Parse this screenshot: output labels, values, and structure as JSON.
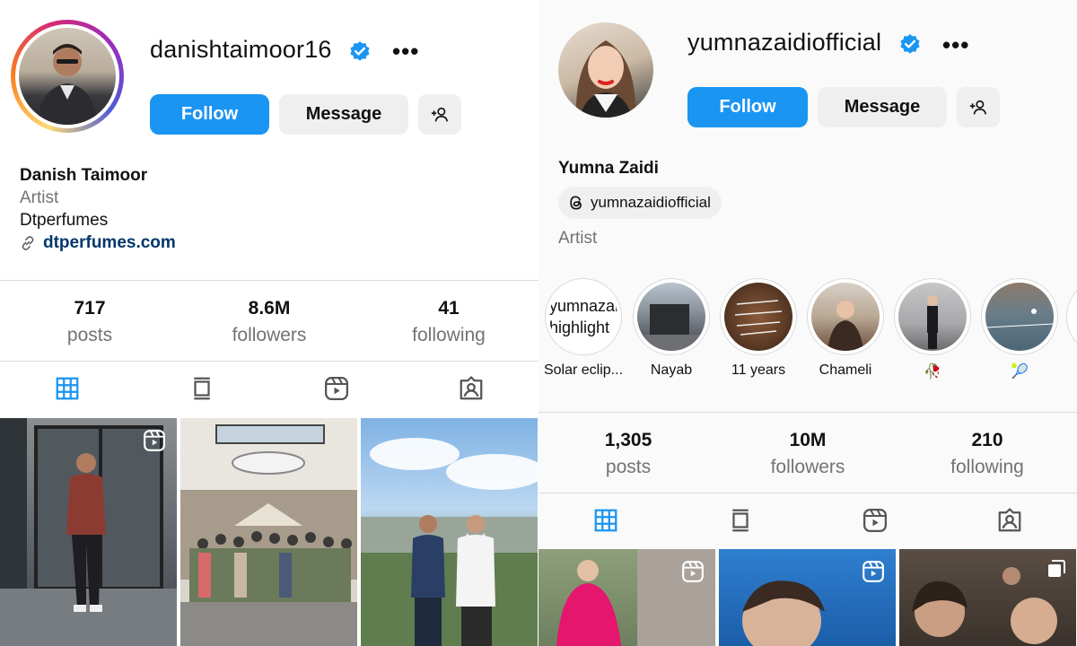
{
  "left_profile": {
    "username": "danishtaimoor16",
    "more": "•••",
    "buttons": {
      "follow": "Follow",
      "message": "Message"
    },
    "name": "Danish Taimoor",
    "category": "Artist",
    "bio": "Dtperfumes",
    "link": "dtperfumes.com",
    "stats": [
      {
        "num": "717",
        "label": "posts"
      },
      {
        "num": "8.6M",
        "label": "followers"
      },
      {
        "num": "41",
        "label": "following"
      }
    ]
  },
  "right_profile": {
    "username": "yumnazaidiofficial",
    "more": "•••",
    "buttons": {
      "follow": "Follow",
      "message": "Message"
    },
    "name": "Yumna Zaidi",
    "threads_handle": "yumnazaidiofficial",
    "category": "Artist",
    "highlights": [
      {
        "label": "Solar eclip...",
        "broken_alt": "yumnazaidi highlight"
      },
      {
        "label": "Nayab"
      },
      {
        "label": "11 years"
      },
      {
        "label": "Chameli"
      },
      {
        "label": "🥀"
      },
      {
        "label": "🎾"
      }
    ],
    "stats": [
      {
        "num": "1,305",
        "label": "posts"
      },
      {
        "num": "10M",
        "label": "followers"
      },
      {
        "num": "210",
        "label": "following"
      }
    ]
  },
  "colors": {
    "accent": "#1a95f2",
    "verified": "#1a95f2",
    "link": "#00376b",
    "muted": "#737373"
  },
  "icons": [
    "verified-badge-icon",
    "add-person-icon",
    "link-icon",
    "threads-icon",
    "grid-icon",
    "feed-icon",
    "reels-icon",
    "tagged-icon",
    "reel-overlay-icon",
    "carousel-icon"
  ]
}
